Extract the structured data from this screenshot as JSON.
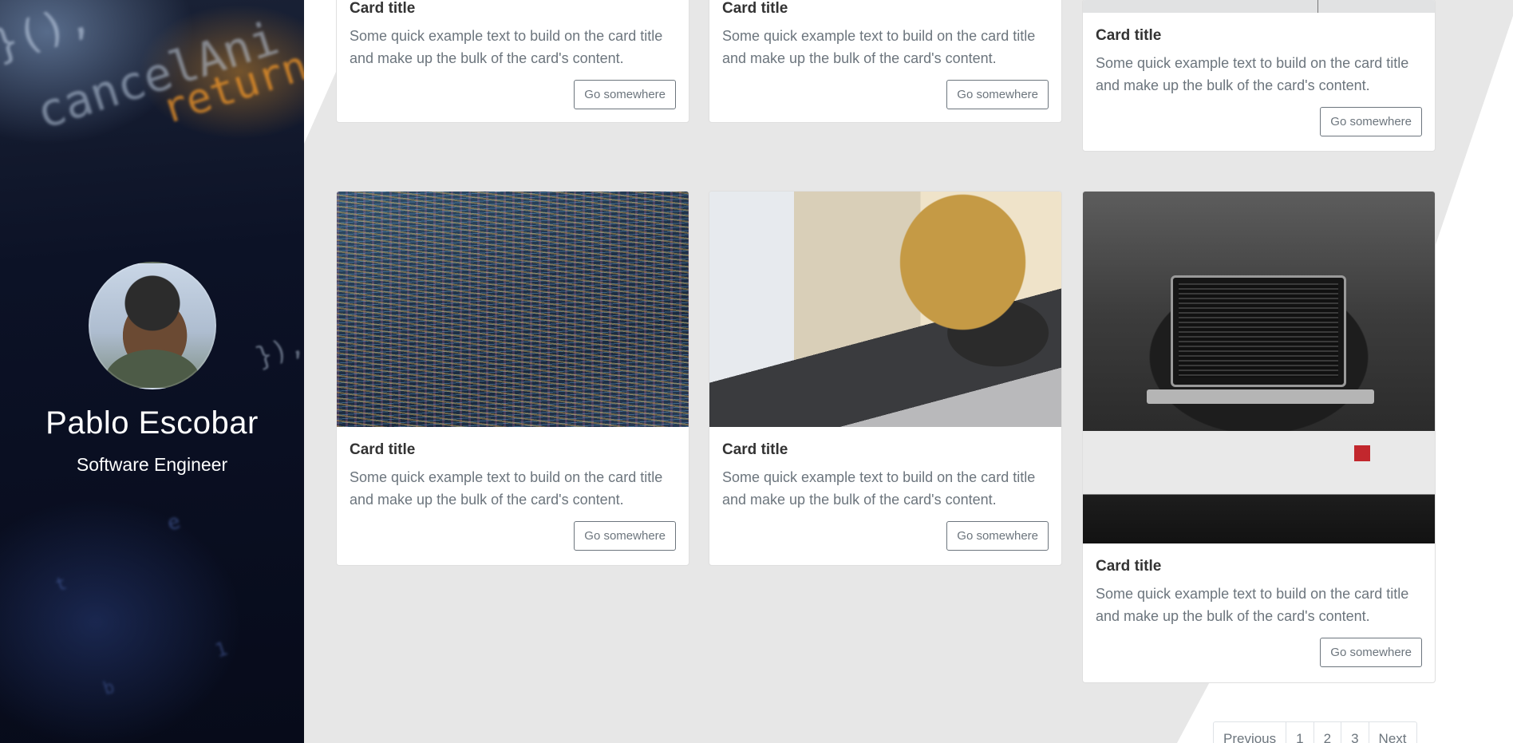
{
  "profile": {
    "name": "Pablo Escobar",
    "role": "Software Engineer"
  },
  "cards": [
    {
      "title": "Card title",
      "text": "Some quick example text to build on the card title and make up the bulk of the card's content.",
      "button": "Go somewhere"
    },
    {
      "title": "Card title",
      "text": "Some quick example text to build on the card title and make up the bulk of the card's content.",
      "button": "Go somewhere"
    },
    {
      "title": "Card title",
      "text": "Some quick example text to build on the card title and make up the bulk of the card's content.",
      "button": "Go somewhere"
    },
    {
      "title": "Card title",
      "text": "Some quick example text to build on the card title and make up the bulk of the card's content.",
      "button": "Go somewhere"
    },
    {
      "title": "Card title",
      "text": "Some quick example text to build on the card title and make up the bulk of the card's content.",
      "button": "Go somewhere"
    },
    {
      "title": "Card title",
      "text": "Some quick example text to build on the card title and make up the bulk of the card's content.",
      "button": "Go somewhere"
    }
  ],
  "pagination": {
    "previous": "Previous",
    "pages": [
      "1",
      "2",
      "3"
    ],
    "next": "Next"
  },
  "colors": {
    "main_background": "#ebebeb",
    "card_background": "#ffffff",
    "button_border": "#6c757d",
    "sidebar_background": "#0a0f22"
  }
}
